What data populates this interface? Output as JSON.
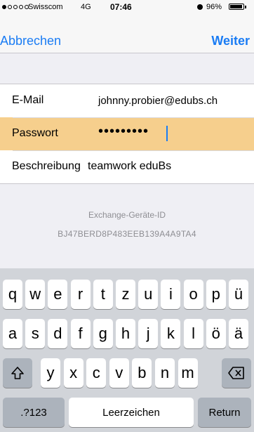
{
  "status_bar": {
    "carrier": "Swisscom",
    "network": "4G",
    "time": "07:46",
    "battery_percent": "96%",
    "signal_bars": 1,
    "battery_level": 0.96,
    "icons": [
      "alarm-icon",
      "battery-icon"
    ]
  },
  "nav": {
    "cancel": "Abbrechen",
    "next": "Weiter",
    "accent_color": "#1a7cf4"
  },
  "form": {
    "email_label": "E-Mail",
    "email_value": "johnny.probier@edubs.ch",
    "password_label": "Passwort",
    "password_value": "•••••••••",
    "description_label": "Beschreibung",
    "description_value": "teamwork eduBs",
    "highlight_color": "#f6cf8d"
  },
  "device": {
    "label": "Exchange-Geräte-ID",
    "id": "BJ47BERD8P483EEB139A4A9TA4"
  },
  "keyboard": {
    "row1": [
      "q",
      "w",
      "e",
      "r",
      "t",
      "z",
      "u",
      "i",
      "o",
      "p",
      "ü"
    ],
    "row2": [
      "a",
      "s",
      "d",
      "f",
      "g",
      "h",
      "j",
      "k",
      "l",
      "ö",
      "ä"
    ],
    "row3": [
      "y",
      "x",
      "c",
      "v",
      "b",
      "n",
      "m"
    ],
    "shift_icon": "shift-icon",
    "delete_icon": "backspace-icon",
    "numbers_label": ".?123",
    "space_label": "Leerzeichen",
    "return_label": "Return"
  }
}
